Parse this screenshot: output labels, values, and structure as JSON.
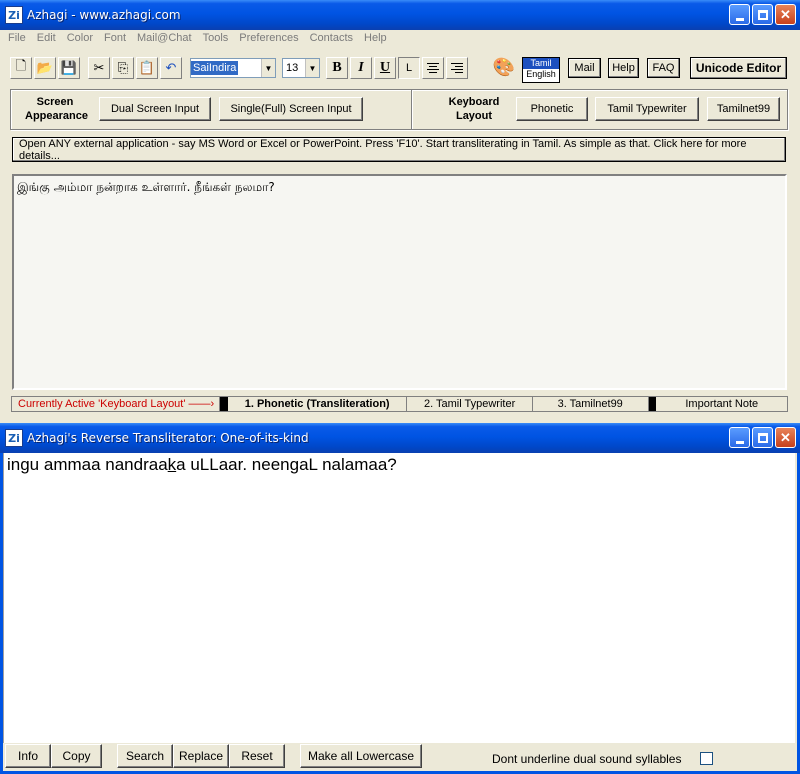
{
  "main_window": {
    "title": "Azhagi - www.azhagi.com",
    "app_icon": "Zi"
  },
  "menu": [
    "File",
    "Edit",
    "Color",
    "Font",
    "Mail@Chat",
    "Tools",
    "Preferences",
    "Contacts",
    "Help"
  ],
  "toolbar": {
    "font_name": "SaiIndira",
    "font_size": "13",
    "bold_label": "B",
    "italic_label": "I",
    "underline_label": "U",
    "align_left_label": "L",
    "lang_primary": "Tamil",
    "lang_secondary": "English",
    "mail_label": "Mail",
    "help_label": "Help",
    "faq_label": "FAQ",
    "unicode_label": "Unicode Editor"
  },
  "screen_appearance": {
    "label_line1": "Screen",
    "label_line2": "Appearance",
    "dual_label": "Dual Screen Input",
    "single_label": "Single(Full) Screen Input"
  },
  "keyboard_layout": {
    "label_line1": "Keyboard",
    "label_line2": "Layout",
    "phonetic_label": "Phonetic",
    "typewriter_label": "Tamil Typewriter",
    "tamilnet_label": "Tamilnet99"
  },
  "external_app_text": "Open ANY external application - say MS Word or Excel or PowerPoint. Press 'F10'. Start transliterating in Tamil. As simple as that. Click here for more details...",
  "editor_text": "இங்கு அம்மா நன்றாக உள்ளார். நீங்கள் நலமா?",
  "status": {
    "active_label": "Currently Active 'Keyboard Layout' ——›",
    "layout1": "1. Phonetic (Transliteration)",
    "layout2": "2. Tamil Typewriter",
    "layout3": "3. Tamilnet99",
    "important_note": "Important Note"
  },
  "reverse_window": {
    "title": "Azhagi's Reverse Transliterator: One-of-its-kind",
    "text_before": "ingu ammaa nandraa",
    "text_underlined": "k",
    "text_after": "a uLLaar. neengaL nalamaa?"
  },
  "bottom_bar": {
    "info_label": "Info",
    "copy_label": "Copy",
    "search_label": "Search",
    "replace_label": "Replace",
    "reset_label": "Reset",
    "lowercase_label": "Make all Lowercase",
    "underline_option": "Dont underline dual sound syllables",
    "underline_checked": false
  },
  "colors": {
    "titlebar": "#0054e3",
    "status_active": "#cc0000",
    "lang_on": "#1c4fbf",
    "selection": "#316ac5"
  }
}
